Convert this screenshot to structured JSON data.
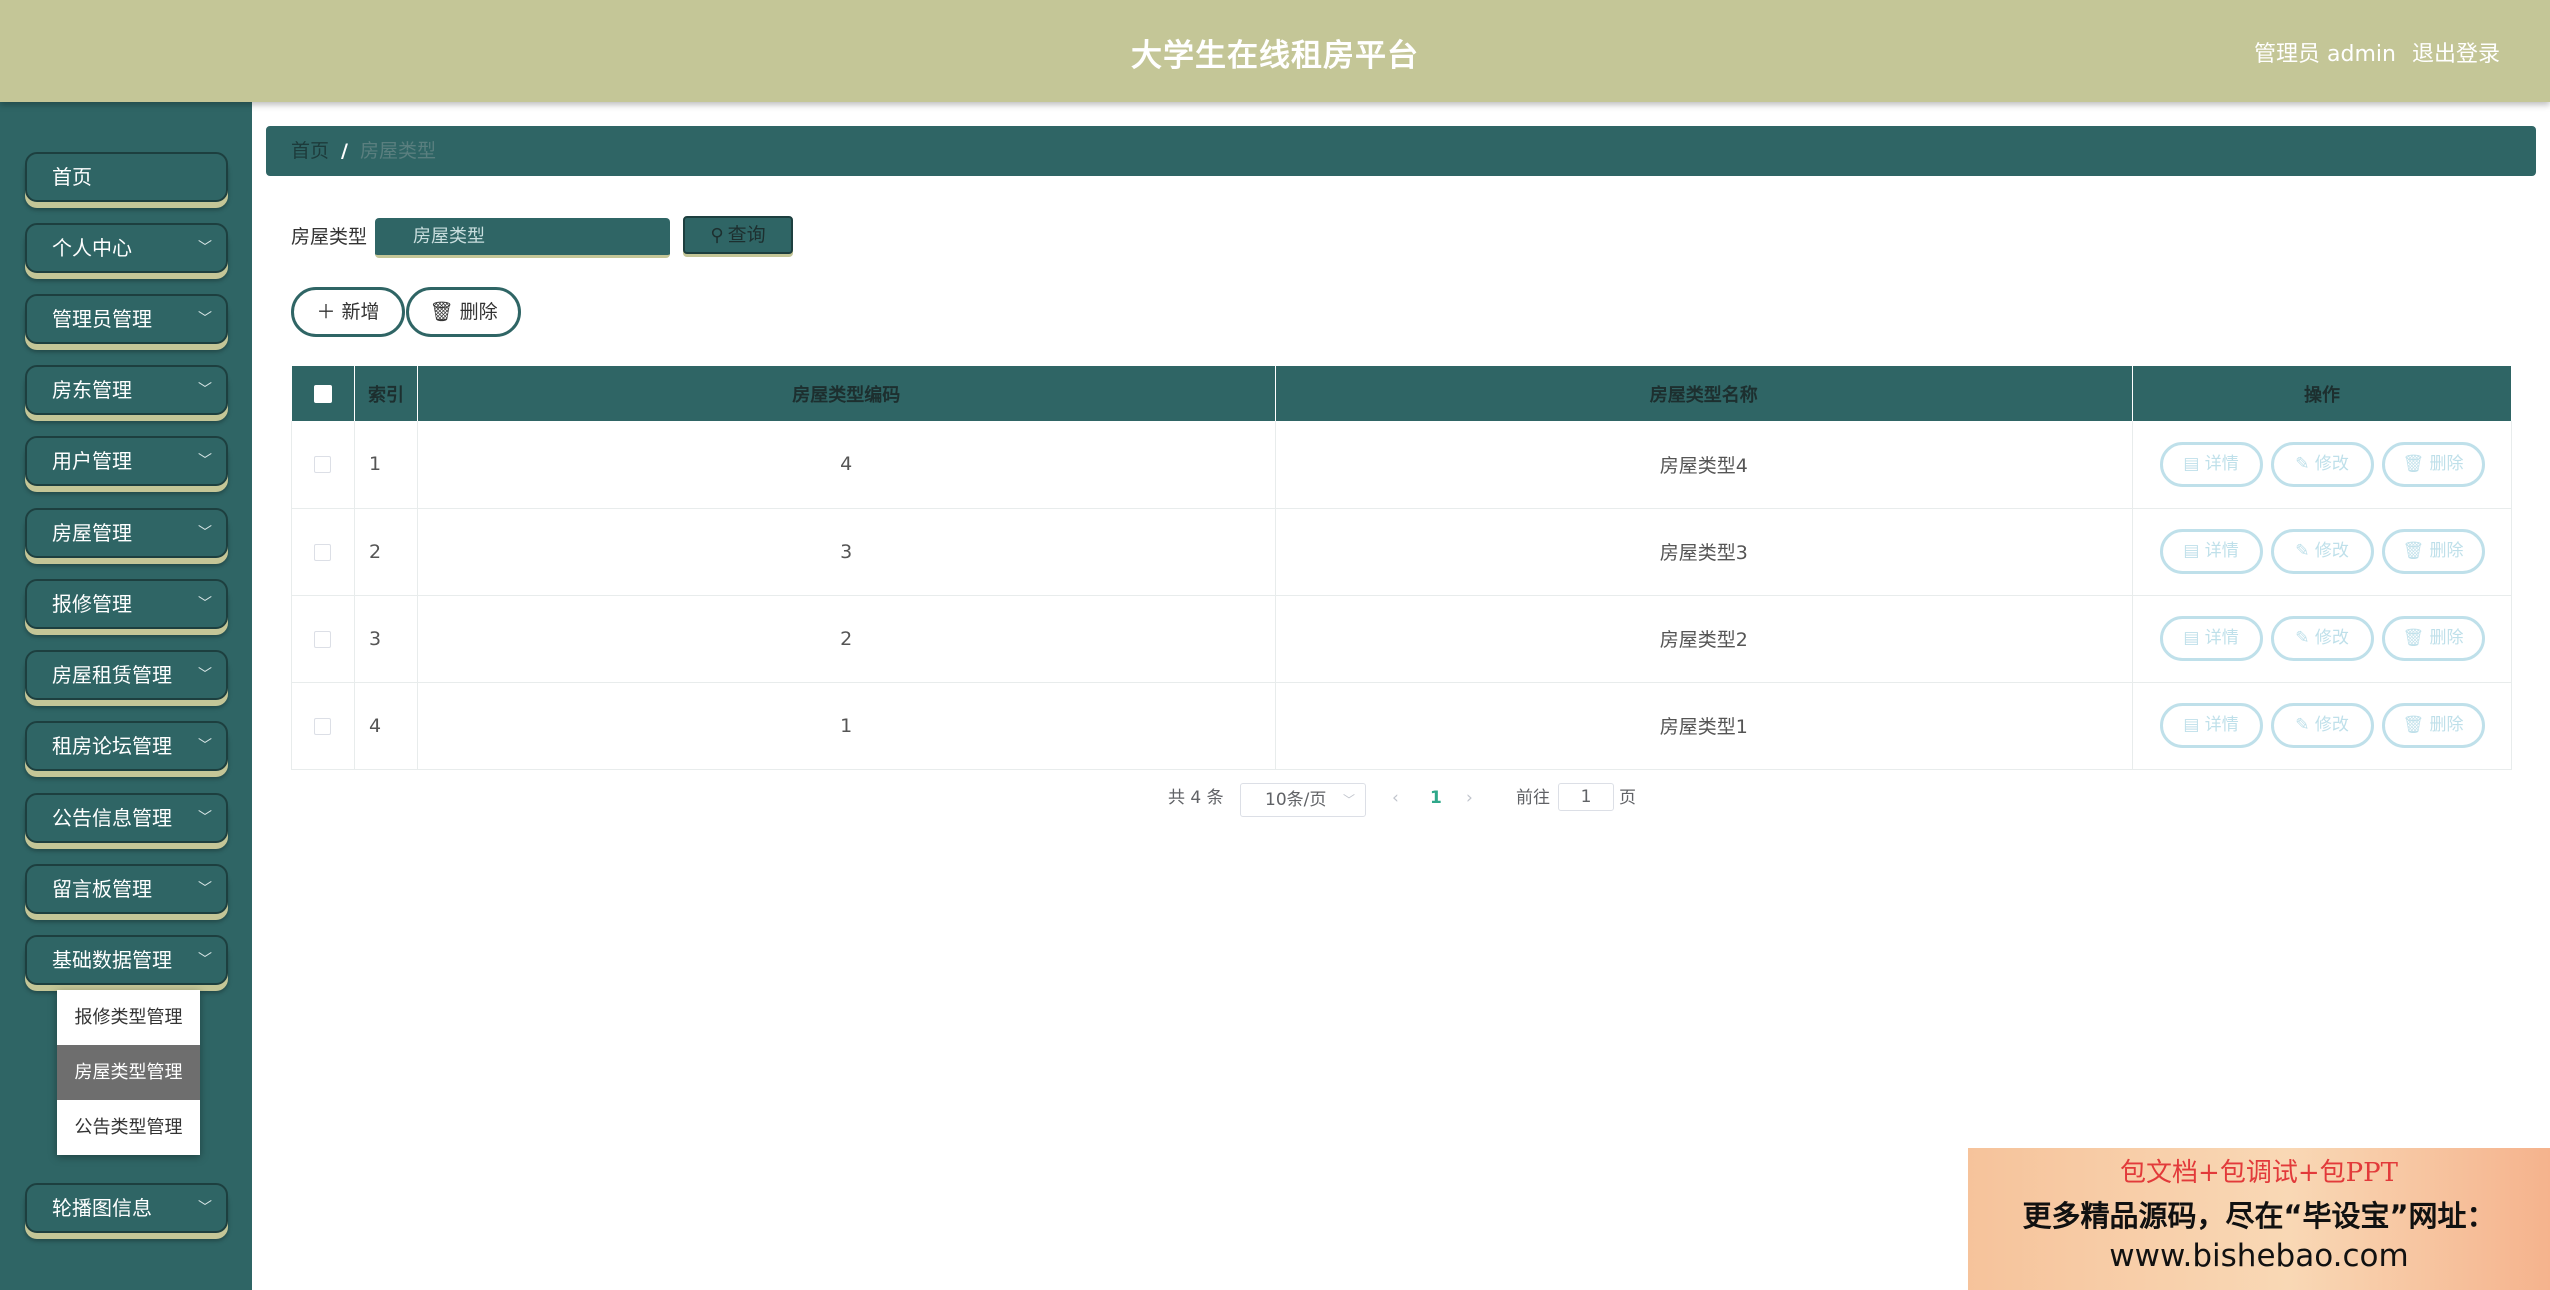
{
  "header": {
    "title": "大学生在线租房平台",
    "user": "管理员 admin",
    "logout": "退出登录"
  },
  "sidebar": {
    "items": [
      {
        "label": "首页",
        "chevron": ""
      },
      {
        "label": "个人中心",
        "chevron": "﹀"
      },
      {
        "label": "管理员管理",
        "chevron": "﹀"
      },
      {
        "label": "房东管理",
        "chevron": "﹀"
      },
      {
        "label": "用户管理",
        "chevron": "﹀"
      },
      {
        "label": "房屋管理",
        "chevron": "﹀"
      },
      {
        "label": "报修管理",
        "chevron": "﹀"
      },
      {
        "label": "房屋租赁管理",
        "chevron": "﹀"
      },
      {
        "label": "租房论坛管理",
        "chevron": "﹀"
      },
      {
        "label": "公告信息管理",
        "chevron": "﹀"
      },
      {
        "label": "留言板管理",
        "chevron": "﹀"
      },
      {
        "label": "基础数据管理",
        "chevron": "﹀"
      },
      {
        "label": "轮播图信息",
        "chevron": "﹀"
      }
    ],
    "submenu": [
      {
        "label": "报修类型管理"
      },
      {
        "label": "房屋类型管理"
      },
      {
        "label": "公告类型管理"
      }
    ]
  },
  "breadcrumb": {
    "home": "首页",
    "separator": "/",
    "current": "房屋类型"
  },
  "search": {
    "label": "房屋类型",
    "placeholder": "房屋类型",
    "button": "查询",
    "button_icon": "search-icon"
  },
  "actions": {
    "add": "新增",
    "add_icon": "plus-icon",
    "delete": "删除",
    "delete_icon": "trash-icon"
  },
  "table": {
    "headers": [
      "索引",
      "房屋类型编码",
      "房屋类型名称",
      "操作"
    ],
    "rows": [
      {
        "index": "1",
        "code": "4",
        "name": "房屋类型4"
      },
      {
        "index": "2",
        "code": "3",
        "name": "房屋类型3"
      },
      {
        "index": "3",
        "code": "2",
        "name": "房屋类型2"
      },
      {
        "index": "4",
        "code": "1",
        "name": "房屋类型1"
      }
    ],
    "row_actions": {
      "detail": "详情",
      "edit": "修改",
      "delete": "删除"
    }
  },
  "pagination": {
    "total": "共 4 条",
    "page_size": "10条/页",
    "current_page": "1",
    "goto_label": "前往",
    "goto_value": "1",
    "goto_unit": "页"
  },
  "promo": {
    "line1": "包文档+包调试+包PPT",
    "line2": "更多精品源码，尽在“毕设宝”网址：",
    "line3": "www.bishebao.com"
  },
  "colors": {
    "header_bg": "#c4c697",
    "sidebar_bg": "#2f6565",
    "accent_underline": "#c4c697",
    "active_submenu": "#6e6e6e",
    "row_action_border": "#bfe0ea"
  }
}
